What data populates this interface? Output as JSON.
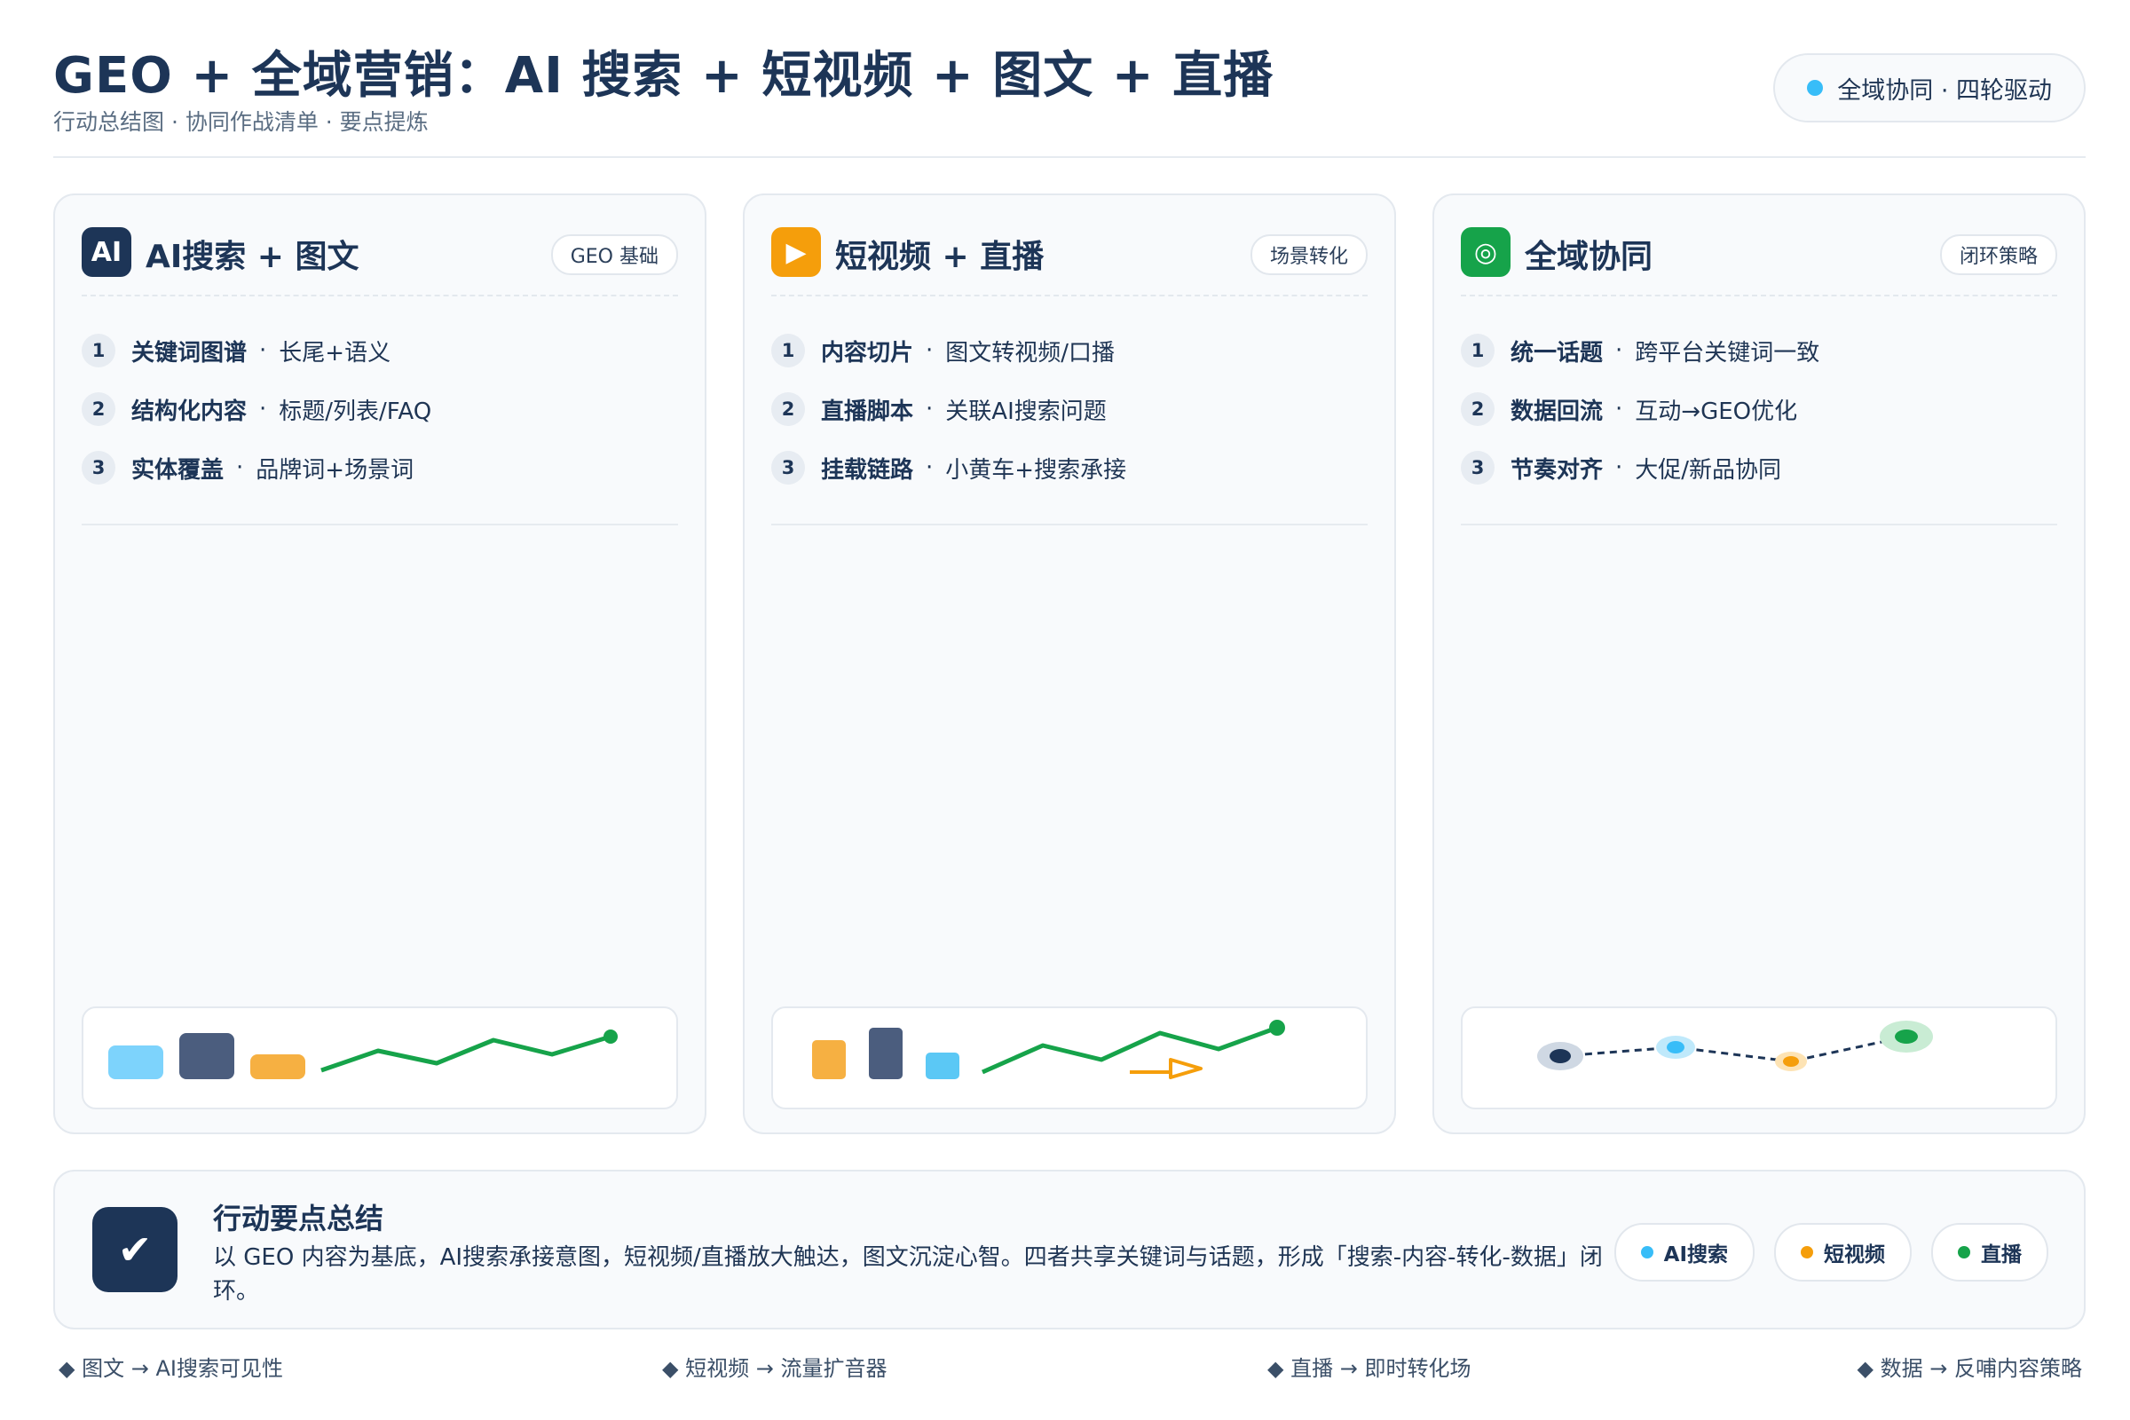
{
  "header": {
    "title": "GEO + 全域营销：AI 搜索 + 短视频 + 图文 + 直播",
    "subtitle": "行动总结图 · 协同作战清单 · 要点提炼",
    "badge": "全域协同 · 四轮驱动",
    "badge_dot_color": "#38bdf8"
  },
  "cards": [
    {
      "icon_text": "AI",
      "icon_name": "ai-icon",
      "icon_color": "#1d3557",
      "title": "AI搜索 + 图文",
      "tag": "GEO 基础",
      "items": [
        {
          "num": "1",
          "key": "关键词图谱",
          "sep": "·",
          "desc": "长尾+语义"
        },
        {
          "num": "2",
          "key": "结构化内容",
          "sep": "·",
          "desc": "标题/列表/FAQ"
        },
        {
          "num": "3",
          "key": "实体覆盖",
          "sep": "·",
          "desc": "品牌词+场景词"
        }
      ]
    },
    {
      "icon_text": "▶",
      "icon_name": "play-icon",
      "icon_color": "#f59e0b",
      "title": "短视频 + 直播",
      "tag": "场景转化",
      "items": [
        {
          "num": "1",
          "key": "内容切片",
          "sep": "·",
          "desc": "图文转视频/口播"
        },
        {
          "num": "2",
          "key": "直播脚本",
          "sep": "·",
          "desc": "关联AI搜索问题"
        },
        {
          "num": "3",
          "key": "挂载链路",
          "sep": "·",
          "desc": "小黄车+搜索承接"
        }
      ]
    },
    {
      "icon_text": "◎",
      "icon_name": "target-icon",
      "icon_color": "#16a34a",
      "title": "全域协同",
      "tag": "闭环策略",
      "items": [
        {
          "num": "1",
          "key": "统一话题",
          "sep": "·",
          "desc": "跨平台关键词一致"
        },
        {
          "num": "2",
          "key": "数据回流",
          "sep": "·",
          "desc": "互动→GEO优化"
        },
        {
          "num": "3",
          "key": "节奏对齐",
          "sep": "·",
          "desc": "大促/新品协同"
        }
      ]
    }
  ],
  "summary": {
    "check": "✔",
    "title": "行动要点总结",
    "text": "以 GEO 内容为基底，AI搜索承接意图，短视频/直播放大触达，图文沉淀心智。四者共享关键词与话题，形成「搜索-内容-转化-数据」闭环。",
    "chips": [
      {
        "label": "AI搜索",
        "color": "#38bdf8"
      },
      {
        "label": "短视频",
        "color": "#f59e0b"
      },
      {
        "label": "直播",
        "color": "#16a34a"
      }
    ]
  },
  "footer": [
    "◆ 图文 → AI搜索可见性",
    "◆ 短视频 → 流量扩音器",
    "◆ 直播 → 即时转化场",
    "◆ 数据 → 反哺内容策略"
  ]
}
